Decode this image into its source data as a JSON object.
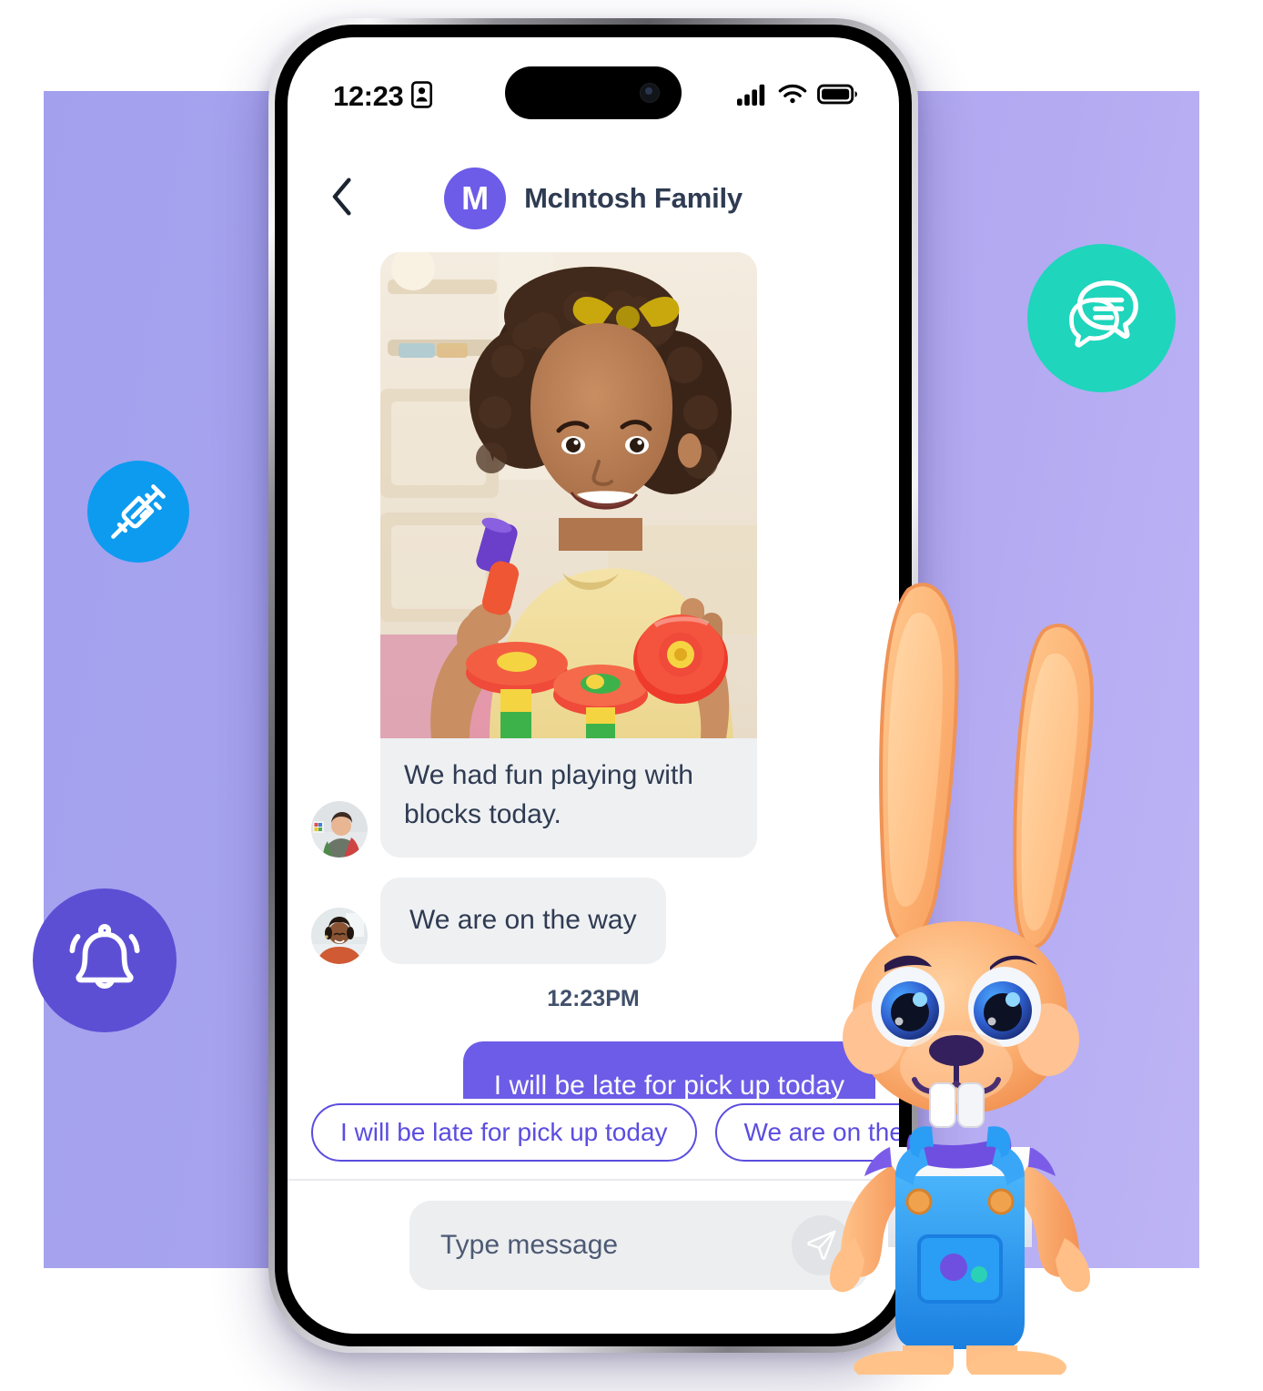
{
  "backdrop": {
    "color": "#a9a4ef"
  },
  "badges": [
    {
      "name": "vaccination",
      "icon": "syringe-icon",
      "color": "#0d9bf0"
    },
    {
      "name": "notifications",
      "icon": "bell-icon",
      "color": "#5c4fd4"
    },
    {
      "name": "messaging",
      "icon": "chat-bubbles-icon",
      "color": "#1fd5bc"
    }
  ],
  "status_bar": {
    "time": "12:23",
    "icons": [
      "id-card-icon",
      "cellular-signal-icon",
      "wifi-icon",
      "battery-icon"
    ]
  },
  "header": {
    "back_icon": "chevron-left-icon",
    "avatar_initial": "M",
    "avatar_color": "#6c5ce7",
    "title": "McIntosh Family"
  },
  "conversation": {
    "messages": [
      {
        "direction": "in",
        "type": "photo",
        "avatar": "teacher-avatar",
        "caption": "We had fun playing with blocks today.",
        "photo_alt": "child holding colorful toy blocks"
      },
      {
        "direction": "in",
        "type": "text",
        "avatar": "parent-avatar",
        "text": "We are on the way"
      }
    ],
    "timestamp": "12:23PM",
    "outgoing": {
      "direction": "out",
      "type": "text",
      "text": "I will be late for pick up today",
      "bubble_color": "#6c5ce7"
    }
  },
  "quick_replies": {
    "accent_color": "#5b4de0",
    "chips": [
      "I will be late for pick up today",
      "We are on the way"
    ]
  },
  "composer": {
    "placeholder": "Type message",
    "value": "",
    "send_icon": "send-paper-plane-icon"
  },
  "mascot": {
    "name": "rabbit-mascot",
    "fur_color": "#f9a25c",
    "overalls_color": "#2a9ef4"
  }
}
